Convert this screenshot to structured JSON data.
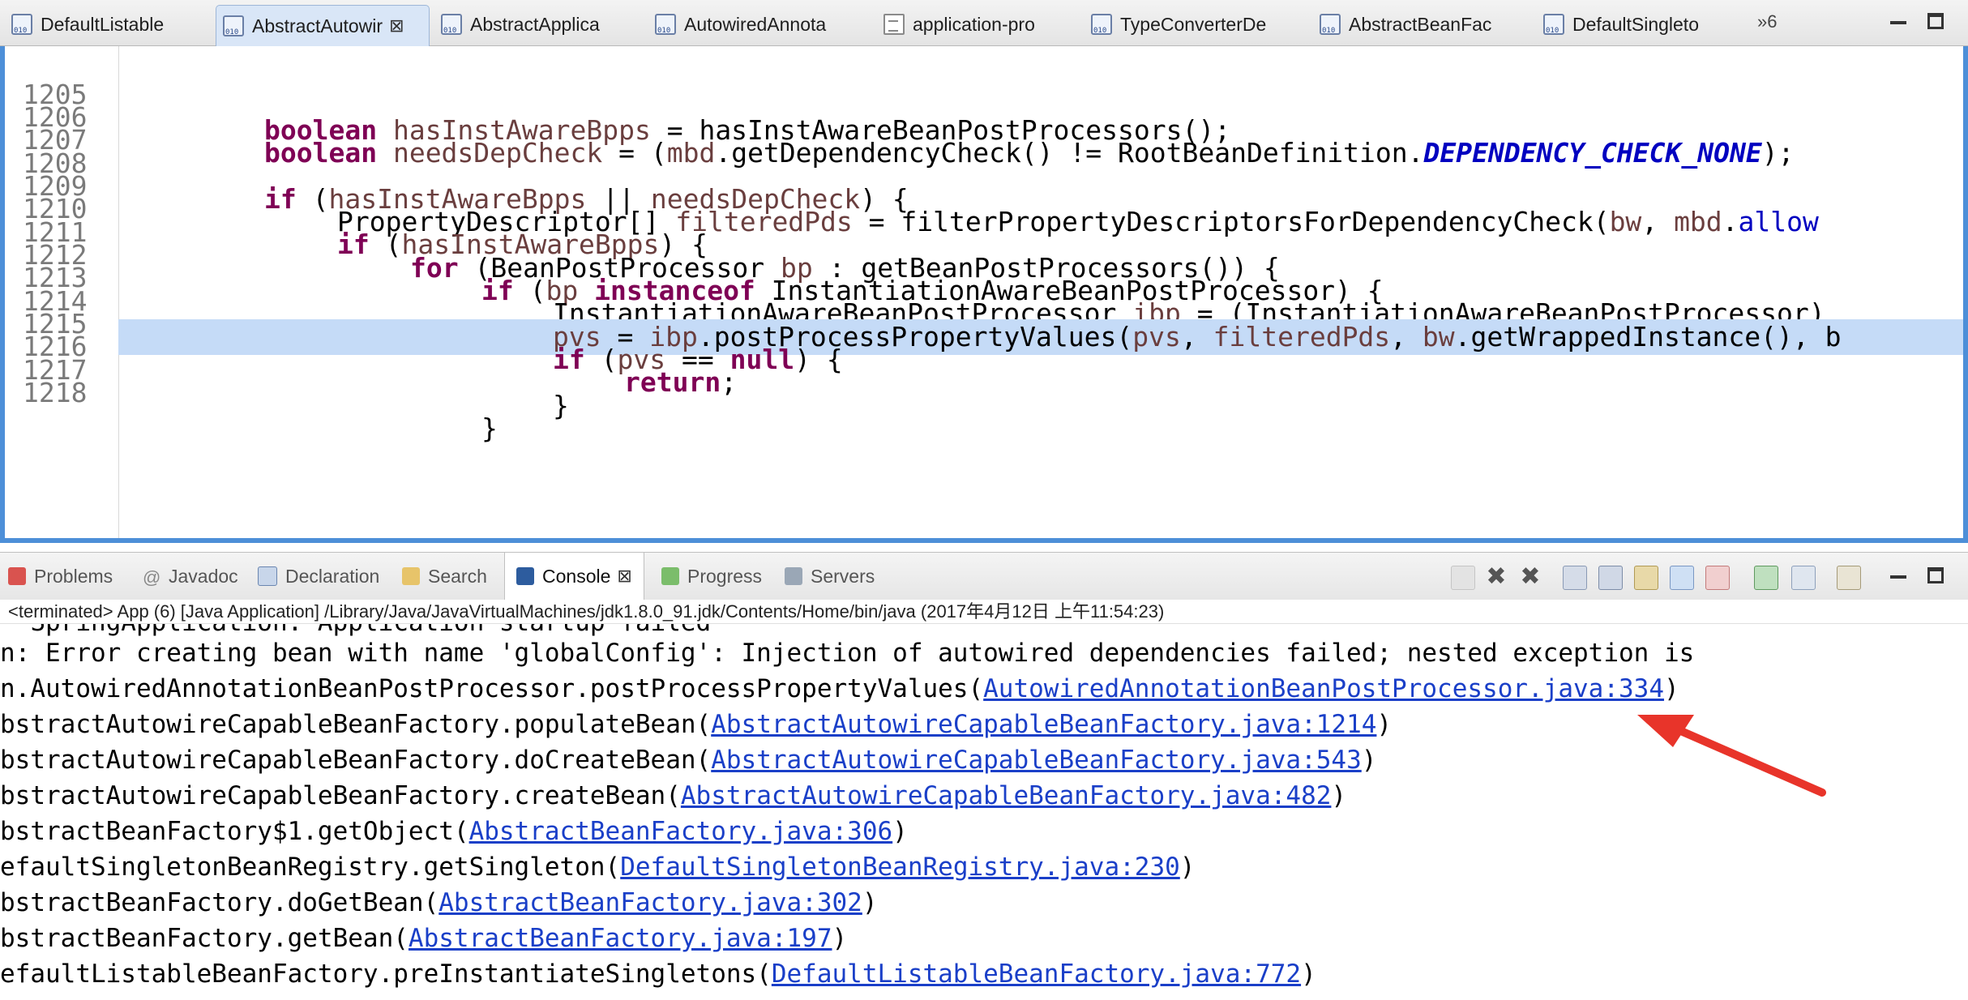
{
  "editor_tabs": [
    {
      "label": "DefaultListable",
      "icon": "class-file-icon"
    },
    {
      "label": "AbstractAutowir",
      "icon": "class-file-icon",
      "active": true
    },
    {
      "label": "AbstractApplica",
      "icon": "class-file-icon"
    },
    {
      "label": "AutowiredAnnota",
      "icon": "class-file-icon"
    },
    {
      "label": "application-pro",
      "icon": "properties-file-icon"
    },
    {
      "label": "TypeConverterDe",
      "icon": "class-file-icon"
    },
    {
      "label": "AbstractBeanFac",
      "icon": "class-file-icon"
    },
    {
      "label": "DefaultSingleto",
      "icon": "class-file-icon"
    }
  ],
  "overflow_tabs": "»6",
  "code_lines": [
    {
      "n": "1205"
    },
    {
      "n": "1206"
    },
    {
      "n": "1207"
    },
    {
      "n": "1208"
    },
    {
      "n": "1209"
    },
    {
      "n": "1210"
    },
    {
      "n": "1211"
    },
    {
      "n": "1212"
    },
    {
      "n": "1213"
    },
    {
      "n": "1214",
      "highlighted": true
    },
    {
      "n": "1215"
    },
    {
      "n": "1216"
    },
    {
      "n": "1217"
    },
    {
      "n": "1218"
    }
  ],
  "code": {
    "l1205": [
      "boolean",
      " ",
      "hasInstAwareBpps",
      " = hasInstAwareBeanPostProcessors();"
    ],
    "l1206": [
      "boolean",
      " ",
      "needsDepCheck",
      " = (",
      "mbd",
      ".getDependencyCheck() != RootBeanDefinition.",
      "DEPENDENCY_CHECK_NONE",
      ");"
    ],
    "l1208": [
      "if",
      " (",
      "hasInstAwareBpps",
      " || ",
      "needsDepCheck",
      ") {"
    ],
    "l1209": [
      "PropertyDescriptor[] ",
      "filteredPds",
      " = filterPropertyDescriptorsForDependencyCheck(",
      "bw",
      ", ",
      "mbd",
      ".",
      "allow"
    ],
    "l1210": [
      "if",
      " (",
      "hasInstAwareBpps",
      ") {"
    ],
    "l1211": [
      "for",
      " (BeanPostProcessor ",
      "bp",
      " : getBeanPostProcessors()) {"
    ],
    "l1212": [
      "if",
      " (",
      "bp",
      " ",
      "instanceof",
      " InstantiationAwareBeanPostProcessor) {"
    ],
    "l1213": [
      "InstantiationAwareBeanPostProcessor ",
      "ibp",
      " = (InstantiationAwareBeanPostProcessor)"
    ],
    "l1214": [
      "pvs",
      " = ",
      "ibp",
      ".postProcessPropertyValues(",
      "pvs",
      ", ",
      "filteredPds",
      ", ",
      "bw",
      ".getWrappedInstance(), ",
      "b"
    ],
    "l1215": [
      "if",
      " (",
      "pvs",
      " == ",
      "null",
      ") {"
    ],
    "l1216": [
      "return",
      ";"
    ],
    "l1217": [
      "}"
    ],
    "l1218": [
      "}"
    ]
  },
  "panel_tabs": [
    {
      "label": "Problems",
      "icon": "problems-icon"
    },
    {
      "label": "Javadoc",
      "icon": "javadoc-icon"
    },
    {
      "label": "Declaration",
      "icon": "declaration-icon"
    },
    {
      "label": "Search",
      "icon": "search-icon"
    },
    {
      "label": "Console",
      "icon": "console-icon",
      "active": true
    },
    {
      "label": "Progress",
      "icon": "progress-icon"
    },
    {
      "label": "Servers",
      "icon": "servers-icon"
    }
  ],
  "console_status": "<terminated> App (6) [Java Application] /Library/Java/JavaVirtualMachines/jdk1.8.0_91.jdk/Contents/Home/bin/java (2017年4月12日 上午11:54:23)",
  "console_partial_top": "  SpringApplication: Application startup failed",
  "console_lines": [
    {
      "text": "n: Error creating bean with name 'globalConfig': Injection of autowired dependencies failed; nested exception is",
      "link": ""
    },
    {
      "text": "n.AutowiredAnnotationBeanPostProcessor.postProcessPropertyValues(",
      "link": "AutowiredAnnotationBeanPostProcessor.java:334",
      "end": ")"
    },
    {
      "text": "bstractAutowireCapableBeanFactory.populateBean(",
      "link": "AbstractAutowireCapableBeanFactory.java:1214",
      "end": ")"
    },
    {
      "text": "bstractAutowireCapableBeanFactory.doCreateBean(",
      "link": "AbstractAutowireCapableBeanFactory.java:543",
      "end": ")"
    },
    {
      "text": "bstractAutowireCapableBeanFactory.createBean(",
      "link": "AbstractAutowireCapableBeanFactory.java:482",
      "end": ")"
    },
    {
      "text": "bstractBeanFactory$1.getObject(",
      "link": "AbstractBeanFactory.java:306",
      "end": ")"
    },
    {
      "text": "efaultSingletonBeanRegistry.getSingleton(",
      "link": "DefaultSingletonBeanRegistry.java:230",
      "end": ")"
    },
    {
      "text": "bstractBeanFactory.doGetBean(",
      "link": "AbstractBeanFactory.java:302",
      "end": ")"
    },
    {
      "text": "bstractBeanFactory.getBean(",
      "link": "AbstractBeanFactory.java:197",
      "end": ")"
    },
    {
      "text": "efaultListableBeanFactory.preInstantiateSingletons(",
      "link": "DefaultListableBeanFactory.java:772",
      "end": ")"
    }
  ],
  "colors": {
    "annotation_arrow": "#e8342a",
    "highlight": "#c5dbf7",
    "link": "#1a3fc8",
    "keyword": "#7f0055"
  }
}
